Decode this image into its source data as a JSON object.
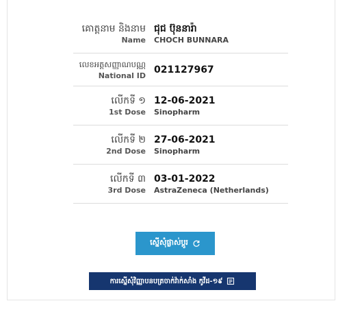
{
  "rows": [
    {
      "label_kh": "គោត្តនាម និងនាម",
      "label_en": "Name",
      "value": "ជុជ ប៊ុននារ៉ា",
      "sub": "CHOCH BUNNARA"
    },
    {
      "label_kh": "លេខអត្តសញ្ញាណបណ្ណ",
      "label_en": "National ID",
      "value": "021127967",
      "sub": ""
    },
    {
      "label_kh": "លើកទី ១",
      "label_en": "1st Dose",
      "value": "12-06-2021",
      "sub": "Sinopharm"
    },
    {
      "label_kh": "លើកទី ២",
      "label_en": "2nd Dose",
      "value": "27-06-2021",
      "sub": "Sinopharm"
    },
    {
      "label_kh": "លើកទី ៣",
      "label_en": "3rd Dose",
      "value": "03-01-2022",
      "sub": "AstraZeneca (Netherlands)"
    }
  ],
  "buttons": {
    "refresh_label": "ស្នើសុំផ្លាស់ប្តូរ",
    "certificate_label": "ការស្នើសុំវិញ្ញាបនបត្រចាក់វ៉ាក់សាំង កូវីដ-១៩"
  },
  "icons": {
    "refresh": "refresh-icon",
    "certificate": "document-icon"
  },
  "colors": {
    "refresh_button": "#2b96cc",
    "certificate_button": "#16366f"
  }
}
